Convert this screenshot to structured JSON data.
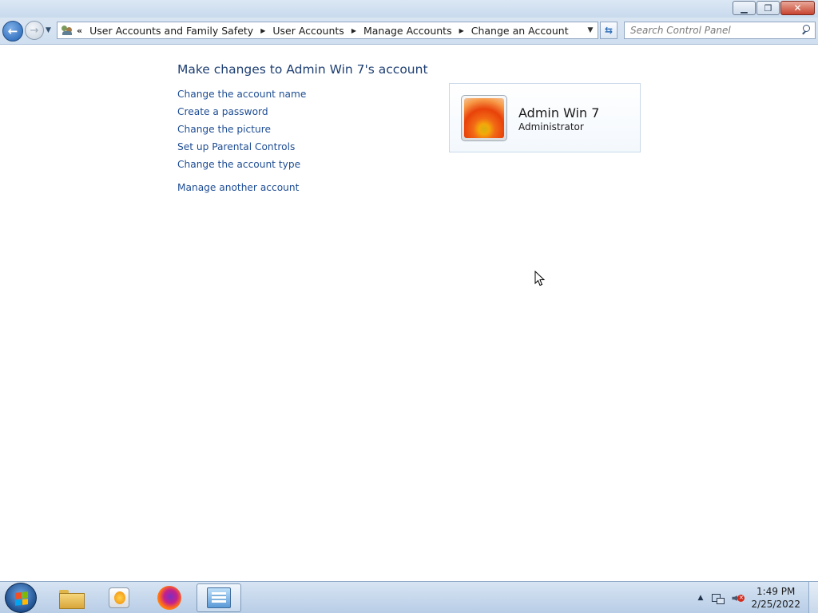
{
  "address_bar": {
    "overflow_symbol": "«",
    "breadcrumbs": [
      "User Accounts and Family Safety",
      "User Accounts",
      "Manage Accounts",
      "Change an Account"
    ]
  },
  "search": {
    "placeholder": "Search Control Panel"
  },
  "content": {
    "heading": "Make changes to Admin Win 7's account",
    "links": [
      "Change the account name",
      "Create a password",
      "Change the picture",
      "Set up Parental Controls",
      "Change the account type"
    ],
    "other_link": "Manage another account"
  },
  "account": {
    "name": "Admin Win 7",
    "role": "Administrator"
  },
  "taskbar": {
    "pinned": [
      "windows-explorer-icon",
      "media-player-icon",
      "firefox-icon",
      "control-panel-icon"
    ],
    "active": "control-panel-icon"
  },
  "clock": {
    "time": "1:49 PM",
    "date": "2/25/2022"
  },
  "colors": {
    "link": "#1e4d94",
    "heading": "#1e3f73",
    "taskbar": "#b8cde6"
  }
}
